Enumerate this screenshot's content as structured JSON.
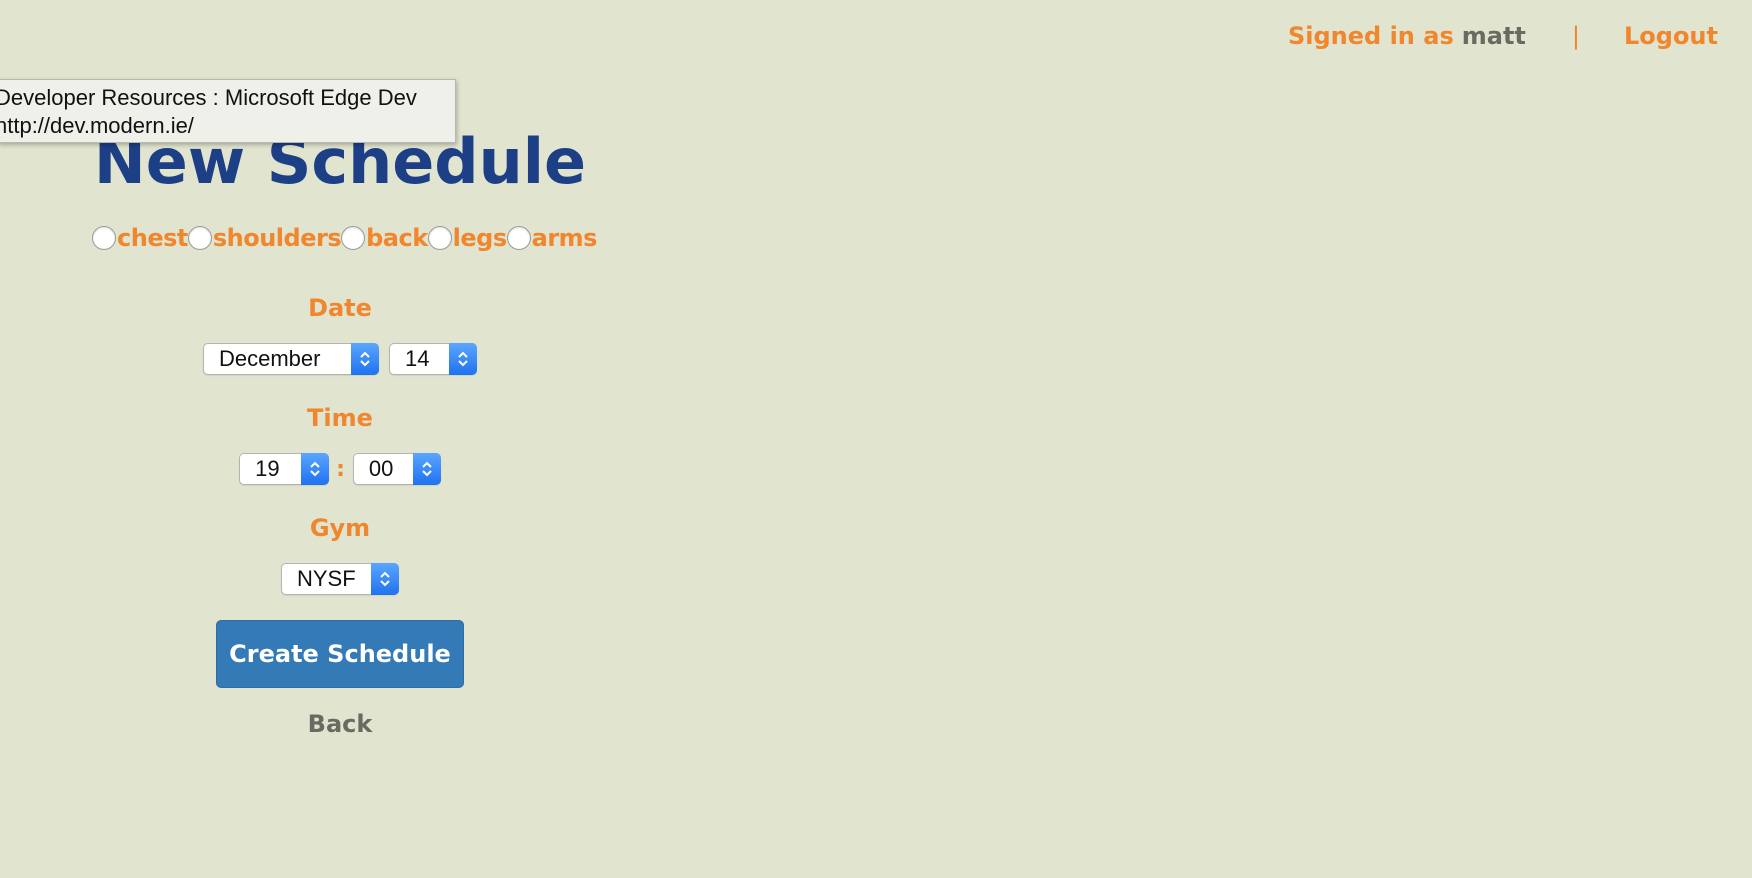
{
  "header": {
    "signed_in_label": "Signed in as",
    "username": "matt",
    "separator": "|",
    "logout_label": "Logout"
  },
  "tooltip": {
    "line1": "Developer Resources : Microsoft Edge Dev",
    "line2": "http://dev.modern.ie/"
  },
  "form": {
    "title": "New Schedule",
    "muscles": [
      {
        "label": "chest",
        "checked": false
      },
      {
        "label": "shoulders",
        "checked": false
      },
      {
        "label": "back",
        "checked": false
      },
      {
        "label": "legs",
        "checked": false
      },
      {
        "label": "arms",
        "checked": false
      }
    ],
    "date_label": "Date",
    "date_month": "December",
    "date_day": "14",
    "time_label": "Time",
    "time_hour": "19",
    "time_separator": ":",
    "time_minute": "00",
    "gym_label": "Gym",
    "gym_value": "NYSF",
    "create_label": "Create Schedule",
    "back_label": "Back"
  },
  "colors": {
    "background": "#e1e4ce",
    "accent": "#f0862d",
    "title": "#1d3f86",
    "button": "#337ab7",
    "muted": "#6a6a62"
  }
}
